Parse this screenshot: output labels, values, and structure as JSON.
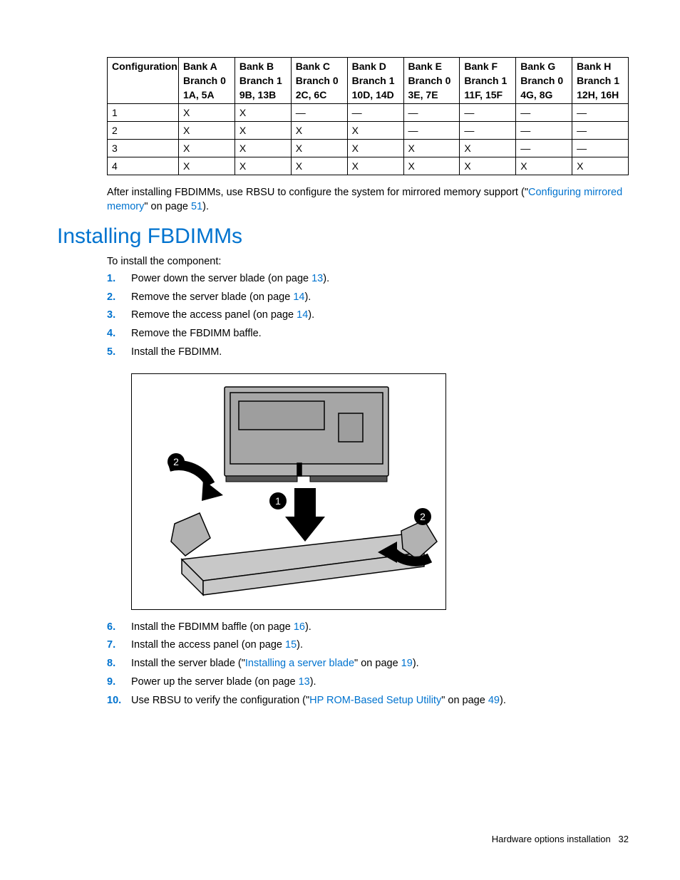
{
  "table": {
    "headers": [
      {
        "c0": "Configuration",
        "c1": "Bank A",
        "c2": "Bank B",
        "c3": "Bank C",
        "c4": "Bank D",
        "c5": "Bank E",
        "c6": "Bank F",
        "c7": "Bank G",
        "c8": "Bank H"
      },
      {
        "c0": "",
        "c1": "Branch 0",
        "c2": "Branch 1",
        "c3": "Branch 0",
        "c4": "Branch 1",
        "c5": "Branch 0",
        "c6": "Branch 1",
        "c7": "Branch 0",
        "c8": "Branch 1"
      },
      {
        "c0": "",
        "c1": "1A, 5A",
        "c2": "9B, 13B",
        "c3": "2C, 6C",
        "c4": "10D, 14D",
        "c5": "3E, 7E",
        "c6": "11F, 15F",
        "c7": "4G, 8G",
        "c8": "12H, 16H"
      }
    ],
    "rows": [
      {
        "c0": "1",
        "c1": "X",
        "c2": "X",
        "c3": "—",
        "c4": "—",
        "c5": "—",
        "c6": "—",
        "c7": "—",
        "c8": "—"
      },
      {
        "c0": "2",
        "c1": "X",
        "c2": "X",
        "c3": "X",
        "c4": "X",
        "c5": "—",
        "c6": "—",
        "c7": "—",
        "c8": "—"
      },
      {
        "c0": "3",
        "c1": "X",
        "c2": "X",
        "c3": "X",
        "c4": "X",
        "c5": "X",
        "c6": "X",
        "c7": "—",
        "c8": "—"
      },
      {
        "c0": "4",
        "c1": "X",
        "c2": "X",
        "c3": "X",
        "c4": "X",
        "c5": "X",
        "c6": "X",
        "c7": "X",
        "c8": "X"
      }
    ]
  },
  "post_table_para": {
    "pre": "After installing FBDIMMs, use RBSU to configure the system for mirrored memory support (\"",
    "link1": "Configuring mirrored memory",
    "mid": "\" on page ",
    "page1": "51",
    "post": ")."
  },
  "section_heading": "Installing FBDIMMs",
  "intro": "To install the component:",
  "steps": [
    {
      "num": "1.",
      "pre": "Power down the server blade (on page ",
      "page": "13",
      "post": ")."
    },
    {
      "num": "2.",
      "pre": "Remove the server blade (on page ",
      "page": "14",
      "post": ")."
    },
    {
      "num": "3.",
      "pre": "Remove the access panel (on page ",
      "page": "14",
      "post": ")."
    },
    {
      "num": "4.",
      "pre": "Remove the FBDIMM baffle.",
      "page": "",
      "post": ""
    },
    {
      "num": "5.",
      "pre": "Install the FBDIMM.",
      "page": "",
      "post": ""
    }
  ],
  "steps2": [
    {
      "num": "6.",
      "pre": "Install the FBDIMM baffle (on page ",
      "page": "16",
      "post": ")."
    },
    {
      "num": "7.",
      "pre": "Install the access panel (on page ",
      "page": "15",
      "post": ")."
    },
    {
      "num": "8.",
      "pre": "Install the server blade (\"",
      "link": "Installing a server blade",
      "mid": "\" on page ",
      "page": "19",
      "post": ")."
    },
    {
      "num": "9.",
      "pre": "Power up the server blade (on page ",
      "page": "13",
      "post": ")."
    },
    {
      "num": "10.",
      "pre": "Use RBSU to verify the configuration (\"",
      "link": "HP ROM-Based Setup Utility",
      "mid": "\" on page ",
      "page": "49",
      "post": ")."
    }
  ],
  "diagram": {
    "callout1": "1",
    "callout2a": "2",
    "callout2b": "2"
  },
  "footer": {
    "section": "Hardware options installation",
    "page": "32"
  }
}
